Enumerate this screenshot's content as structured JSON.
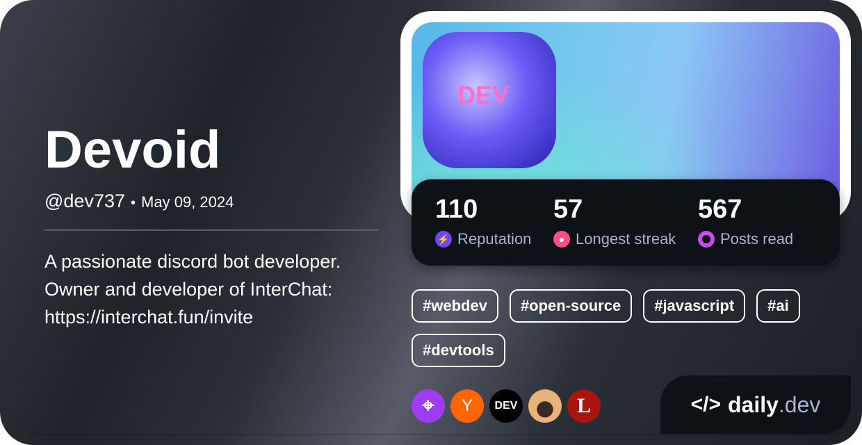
{
  "profile": {
    "name": "Devoid",
    "handle": "@dev737",
    "separator": "•",
    "joined": "May 09, 2024",
    "bio": "A passionate discord bot developer. Owner and developer of InterChat: https://interchat.fun/invite",
    "avatar_text": "DEV"
  },
  "stats": [
    {
      "value": "110",
      "label": "Reputation",
      "icon": "lightning-icon",
      "color": "#7147ed"
    },
    {
      "value": "57",
      "label": "Longest streak",
      "icon": "flame-icon",
      "color": "#ff4f87"
    },
    {
      "value": "567",
      "label": "Posts read",
      "icon": "ring-icon",
      "color": "#c84ce8"
    }
  ],
  "tags": [
    "#webdev",
    "#open-source",
    "#javascript",
    "#ai",
    "#devtools"
  ],
  "sources": [
    {
      "name": "crosshair-source",
      "text": "⌖",
      "color": "#a03cf0"
    },
    {
      "name": "hacker-news-source",
      "text": "Y",
      "color": "#ff6600"
    },
    {
      "name": "dev-to-source",
      "text": "DEV",
      "color": "#000000"
    },
    {
      "name": "devsquad-source",
      "text": "",
      "color": "#e8b27a"
    },
    {
      "name": "l-source",
      "text": "L",
      "color": "#a8150e"
    }
  ],
  "brand": {
    "main": "daily",
    "suffix": ".dev"
  }
}
